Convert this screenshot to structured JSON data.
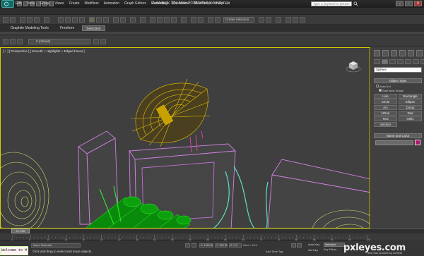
{
  "window": {
    "title": "Autodesk 3ds Max  2010      wmd robot4.max",
    "search_placeholder": "Type a keyword or phrase"
  },
  "menu": [
    "Edit",
    "Tools",
    "Group",
    "Views",
    "Create",
    "Modifiers",
    "Animation",
    "Graph Editors",
    "Rendering",
    "Customize",
    "MAXScript",
    "Help"
  ],
  "toolbar": {
    "selection_set_placeholder": "Create Selection"
  },
  "ribbon": {
    "tabs": [
      "Graphite Modeling Tools",
      "Freeform",
      "Selection"
    ],
    "active": "Selection"
  },
  "layer": {
    "current": "0 (default)"
  },
  "viewport": {
    "label": "[ + ] [ Perspective ] [ Smooth + Highlights + Edged Faces ]",
    "colors": {
      "border_active": "#d8d000",
      "dish": "#e8c000",
      "tubes": "#00d000",
      "boxes": "#d080e0",
      "wires": "#60e0c0",
      "left_object": "#e0f070",
      "magenta_part": "#e040a0"
    }
  },
  "command_panel": {
    "category": "Splines",
    "object_type_title": "Object Type",
    "autogrid_label": "AutoGrid",
    "start_new_label": "Start New Shape",
    "buttons": [
      "Line",
      "Rectangle",
      "Circle",
      "Ellipse",
      "Arc",
      "Donut",
      "NGon",
      "Star",
      "Text",
      "Helix",
      "Section"
    ],
    "name_color_title": "Name and Color",
    "swatch_color": "#b01870"
  },
  "timeline": {
    "slider_label": "0 / 100",
    "ticks": [
      "0",
      "5",
      "10",
      "15",
      "20",
      "25",
      "30",
      "35",
      "40",
      "45",
      "50",
      "55",
      "60",
      "65",
      "70",
      "75",
      "80",
      "85",
      "90",
      "95",
      "100"
    ]
  },
  "status": {
    "listener": "Welcome to M",
    "selection": "None Selected",
    "prompt": "Click and drag to select and move objects",
    "x": "X: 1001.963",
    "y": "Y: 150.261",
    "z": "Z: 0.0",
    "grid": "Grid = 10.0",
    "add_time_tag": "Add Time Tag",
    "auto_key": "Auto Key",
    "set_key": "Set Key",
    "selected": "Selected",
    "key_filters": "Key Filters..."
  },
  "watermark": {
    "text": "pxleyes.com",
    "subtext": "3ds max photoshop contest"
  }
}
